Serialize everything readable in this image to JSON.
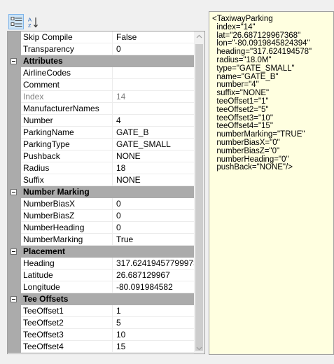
{
  "toolbar": {
    "categorized_tooltip": "",
    "alphabetical_tooltip": ""
  },
  "grid": {
    "rows": [
      {
        "type": "prop",
        "name": "Skip Compile",
        "value": "False"
      },
      {
        "type": "prop",
        "name": "Transparency",
        "value": "0"
      },
      {
        "type": "cat",
        "name": "Attributes"
      },
      {
        "type": "prop",
        "name": "AirlineCodes",
        "value": ""
      },
      {
        "type": "prop",
        "name": "Comment",
        "value": ""
      },
      {
        "type": "prop",
        "name": "Index",
        "value": "14",
        "readonly": true
      },
      {
        "type": "prop",
        "name": "ManufacturerNames",
        "value": ""
      },
      {
        "type": "prop",
        "name": "Number",
        "value": "4"
      },
      {
        "type": "prop",
        "name": "ParkingName",
        "value": "GATE_B"
      },
      {
        "type": "prop",
        "name": "ParkingType",
        "value": "GATE_SMALL"
      },
      {
        "type": "prop",
        "name": "Pushback",
        "value": "NONE"
      },
      {
        "type": "prop",
        "name": "Radius",
        "value": "18"
      },
      {
        "type": "prop",
        "name": "Suffix",
        "value": "NONE"
      },
      {
        "type": "cat",
        "name": "Number Marking"
      },
      {
        "type": "prop",
        "name": "NumberBiasX",
        "value": "0"
      },
      {
        "type": "prop",
        "name": "NumberBiasZ",
        "value": "0"
      },
      {
        "type": "prop",
        "name": "NumberHeading",
        "value": "0"
      },
      {
        "type": "prop",
        "name": "NumberMarking",
        "value": "True"
      },
      {
        "type": "cat",
        "name": "Placement"
      },
      {
        "type": "prop",
        "name": "Heading",
        "value": "317.62419457799973"
      },
      {
        "type": "prop",
        "name": "Latitude",
        "value": "26.687129967"
      },
      {
        "type": "prop",
        "name": "Longitude",
        "value": "-80.091984582"
      },
      {
        "type": "cat",
        "name": "Tee Offsets"
      },
      {
        "type": "prop",
        "name": "TeeOffset1",
        "value": "1"
      },
      {
        "type": "prop",
        "name": "TeeOffset2",
        "value": "5"
      },
      {
        "type": "prop",
        "name": "TeeOffset3",
        "value": "10"
      },
      {
        "type": "prop",
        "name": "TeeOffset4",
        "value": "15"
      }
    ]
  },
  "xml": {
    "lines": [
      "<TaxiwayParking",
      "  index=\"14\"",
      "  lat=\"26.687129967368\"",
      "  lon=\"-80.0919845824394\"",
      "  heading=\"317.624194578\"",
      "  radius=\"18.0M\"",
      "  type=\"GATE_SMALL\"",
      "  name=\"GATE_B\"",
      "  number=\"4\"",
      "  suffix=\"NONE\"",
      "  teeOffset1=\"1\"",
      "  teeOffset2=\"5\"",
      "  teeOffset3=\"10\"",
      "  teeOffset4=\"15\"",
      "  numberMarking=\"TRUE\"",
      "  numberBiasX=\"0\"",
      "  numberBiasZ=\"0\"",
      "  numberHeading=\"0\"",
      "  pushBack=\"NONE\"/>"
    ]
  },
  "colors": {
    "category_bg": "#ababab",
    "xml_bg": "#ffffe0",
    "readonly_text": "#7f7f7f",
    "active_button_bg": "#cce4f7"
  },
  "icons": {
    "categorized": "categorized-view-icon",
    "alphabetical": "alphabetical-sort-icon",
    "collapse": "collapse-minus-icon"
  }
}
